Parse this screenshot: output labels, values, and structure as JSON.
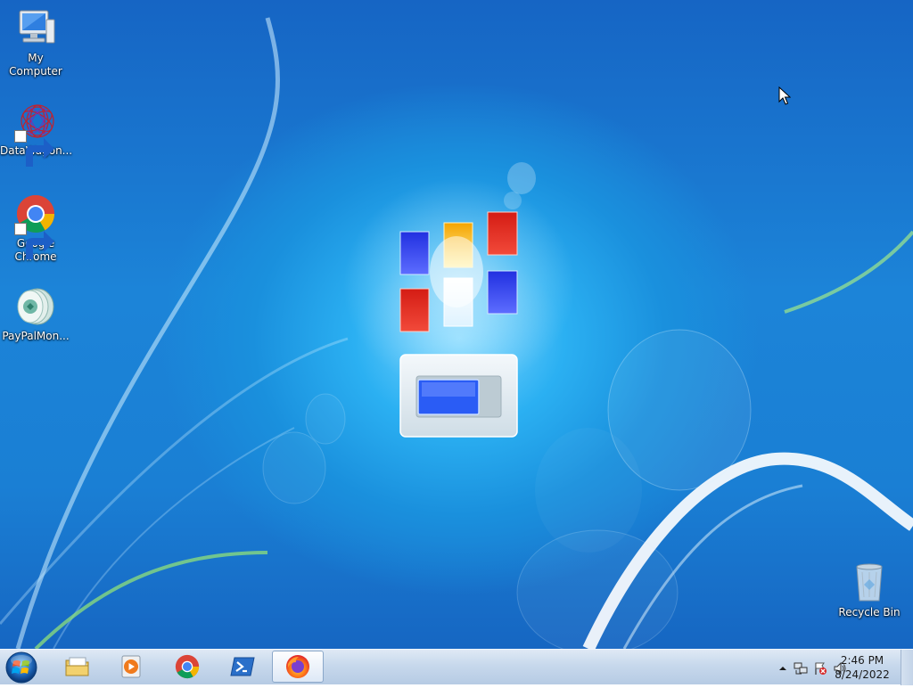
{
  "desktop": {
    "icons": [
      {
        "name": "my-computer",
        "label": "My Computer",
        "icon": "computer-icon",
        "shortcut": false
      },
      {
        "name": "datawagon",
        "label": "DataWagon...",
        "icon": "datawagon-icon",
        "shortcut": true
      },
      {
        "name": "google-chrome",
        "label": "Google Chrome",
        "icon": "chrome-icon",
        "shortcut": true
      },
      {
        "name": "paypalmon",
        "label": "PayPalMon...",
        "icon": "paypalmon-icon",
        "shortcut": false
      },
      {
        "name": "recycle-bin",
        "label": "Recycle Bin",
        "icon": "recycle-bin-icon",
        "shortcut": false
      }
    ],
    "wallpaper": "windows-7-logo-wallpaper"
  },
  "taskbar": {
    "start": {
      "icon": "windows-orb-icon"
    },
    "buttons": [
      {
        "name": "file-explorer",
        "icon": "folder-icon",
        "active": false
      },
      {
        "name": "media-player",
        "icon": "media-player-icon",
        "active": false
      },
      {
        "name": "chrome",
        "icon": "chrome-icon",
        "active": false
      },
      {
        "name": "powershell",
        "icon": "powershell-icon",
        "active": false
      },
      {
        "name": "firefox",
        "icon": "firefox-icon",
        "active": true
      }
    ],
    "tray": {
      "icons": [
        "show-hidden-icons-arrow",
        "network-icon",
        "action-center-flag-icon",
        "volume-icon"
      ],
      "time": "2:46 PM",
      "date": "8/24/2022"
    }
  },
  "colors": {
    "desktop_blue": "#1a86d8",
    "taskbar": "#c7d8ec",
    "tile_blue": "#2a3df0",
    "tile_orange": "#f5a800",
    "tile_red": "#e0261c"
  }
}
